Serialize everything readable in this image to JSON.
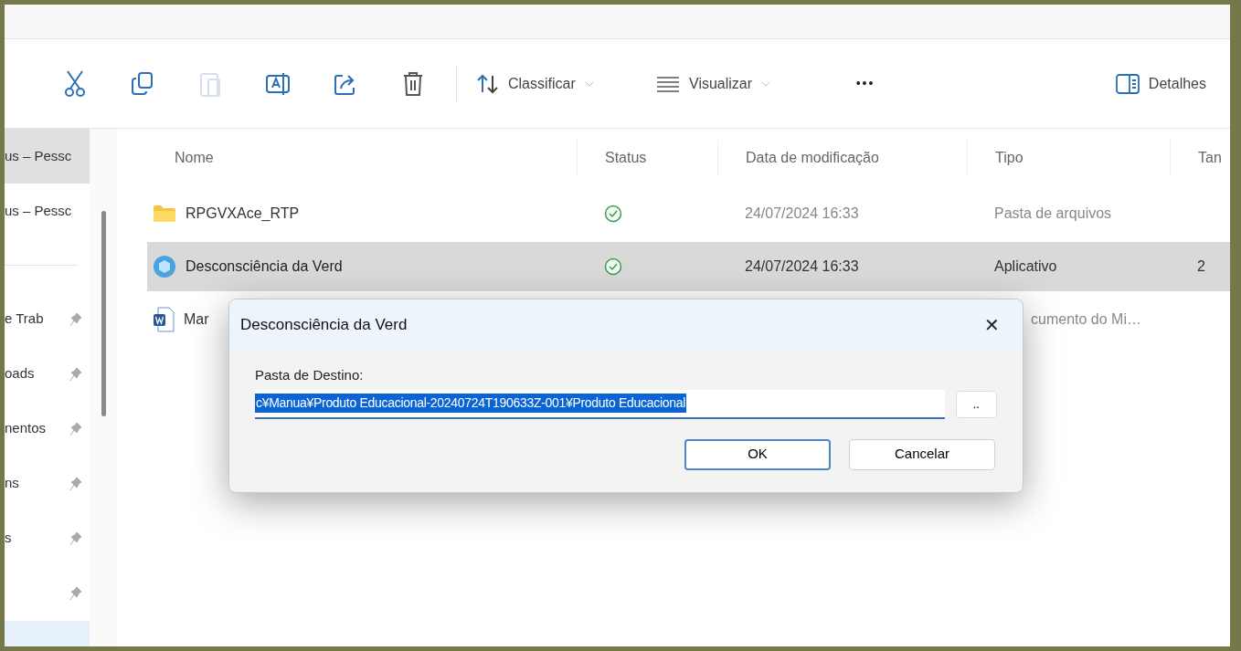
{
  "toolbar": {
    "actions": [
      {
        "kind": "cut",
        "disabled": false
      },
      {
        "kind": "copy",
        "disabled": false
      },
      {
        "kind": "paste",
        "disabled": true
      },
      {
        "kind": "rename",
        "disabled": false
      },
      {
        "kind": "share",
        "disabled": false
      },
      {
        "kind": "delete",
        "disabled": false
      }
    ],
    "sort": {
      "label": "Classificar"
    },
    "view": {
      "label": "Visualizar"
    },
    "more": "•••",
    "details": {
      "label": "Detalhes"
    }
  },
  "sidebar": {
    "items": [
      {
        "label": "us – Pessc",
        "pinned": false,
        "selected": true
      },
      {
        "label": "us – Pessc",
        "pinned": false,
        "selected": false
      },
      {
        "kind": "separator"
      },
      {
        "label": "e Trab",
        "pinned": true,
        "selected": false
      },
      {
        "label": "oads",
        "pinned": true,
        "selected": false
      },
      {
        "label": "nentos",
        "pinned": true,
        "selected": false
      },
      {
        "label": "ns",
        "pinned": true,
        "selected": false
      },
      {
        "label": "s",
        "pinned": true,
        "selected": false
      },
      {
        "pinned": true,
        "selected": false
      }
    ]
  },
  "table": {
    "columns": [
      "Nome",
      "Status",
      "Data de modificação",
      "Tipo",
      "Tan"
    ],
    "rows": [
      {
        "kind": "folder",
        "name": "RPGVXAce_RTP",
        "synced": true,
        "date": "24/07/2024 16:33",
        "type": "Pasta de arquivos",
        "selected": false
      },
      {
        "kind": "app",
        "name": "Desconsciência da Verd",
        "synced": true,
        "date": "24/07/2024 16:33",
        "type": "Aplicativo",
        "size": "2",
        "selected": true
      },
      {
        "kind": "doc",
        "name": "Mar",
        "type": "cumento do Mi…",
        "type_clipped": true,
        "selected": false
      }
    ]
  },
  "dialog": {
    "title": "Desconsciência da Verd",
    "close": "✕",
    "label": "Pasta de Destino:",
    "value": "c¥Manua¥Produto Educacional-20240724T190633Z-001¥Produto Educacional",
    "value_selected": true,
    "browse": "..",
    "buttons": [
      {
        "label": "OK",
        "default": true
      },
      {
        "label": "Cancelar",
        "default": false
      }
    ]
  }
}
